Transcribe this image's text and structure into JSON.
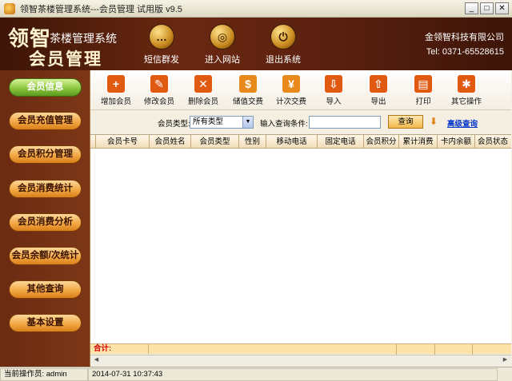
{
  "window": {
    "title": "领智茶楼管理系统---会员管理 试用版 v9.5",
    "controls": [
      "_",
      "□",
      "✕"
    ]
  },
  "header": {
    "brand": "领智",
    "brand_sub": "茶楼管理系统",
    "module": "会员管理",
    "buttons": [
      {
        "label": "短信群发",
        "icon": "chat-bubble-icon"
      },
      {
        "label": "进入网站",
        "icon": "globe-icon"
      },
      {
        "label": "退出系统",
        "icon": "power-icon"
      }
    ],
    "company": "金领智科技有限公司",
    "phone": "Tel: 0371-65528615"
  },
  "sidebar": {
    "items": [
      {
        "label": "会员信息",
        "active": true
      },
      {
        "label": "会员充值管理"
      },
      {
        "label": "会员积分管理"
      },
      {
        "label": "会员消费统计"
      },
      {
        "label": "会员消费分析"
      },
      {
        "label": "会员余额/次统计"
      },
      {
        "label": "其他查询"
      },
      {
        "label": "基本设置"
      }
    ]
  },
  "toolbar": {
    "items": [
      {
        "label": "增加会员",
        "icon": "plus-icon",
        "glyph": "+",
        "color": "#e05a12"
      },
      {
        "label": "修改会员",
        "icon": "pencil-icon",
        "glyph": "✎",
        "color": "#e05a12"
      },
      {
        "label": "删除会员",
        "icon": "delete-x-icon",
        "glyph": "✕",
        "color": "#e05a12"
      },
      {
        "label": "储值交费",
        "icon": "dollar-icon",
        "glyph": "$",
        "color": "#e8891c"
      },
      {
        "label": "计次交费",
        "icon": "yen-icon",
        "glyph": "¥",
        "color": "#e8891c"
      },
      {
        "label": "导入",
        "icon": "import-icon",
        "glyph": "⇩",
        "color": "#e05a12"
      },
      {
        "label": "导出",
        "icon": "export-icon",
        "glyph": "⇧",
        "color": "#e05a12"
      },
      {
        "label": "打印",
        "icon": "printer-icon",
        "glyph": "▤",
        "color": "#e05a12"
      },
      {
        "label": "其它操作",
        "icon": "wrench-icon",
        "glyph": "✱",
        "color": "#e05a12"
      }
    ]
  },
  "filter": {
    "type_label": "会员类型:",
    "type_value": "所有类型",
    "query_label": "输入查询条件:",
    "query_value": "",
    "query_button": "查询",
    "advanced_link": "高级查询"
  },
  "table": {
    "columns": [
      "会员卡号",
      "会员姓名",
      "会员类型",
      "性别",
      "移动电话",
      "固定电话",
      "会员积分",
      "累计消费",
      "卡内余额",
      "会员状态"
    ],
    "rows": [],
    "footer_label": "合计:"
  },
  "status": {
    "operator_label": "当前操作员: admin",
    "datetime": "2014-07-31 10:37:43"
  },
  "colors": {
    "header_bg": "#5a2010",
    "sidebar_bg": "#7c3717",
    "accent_orange": "#f2a844",
    "active_green": "#8dc63f"
  }
}
